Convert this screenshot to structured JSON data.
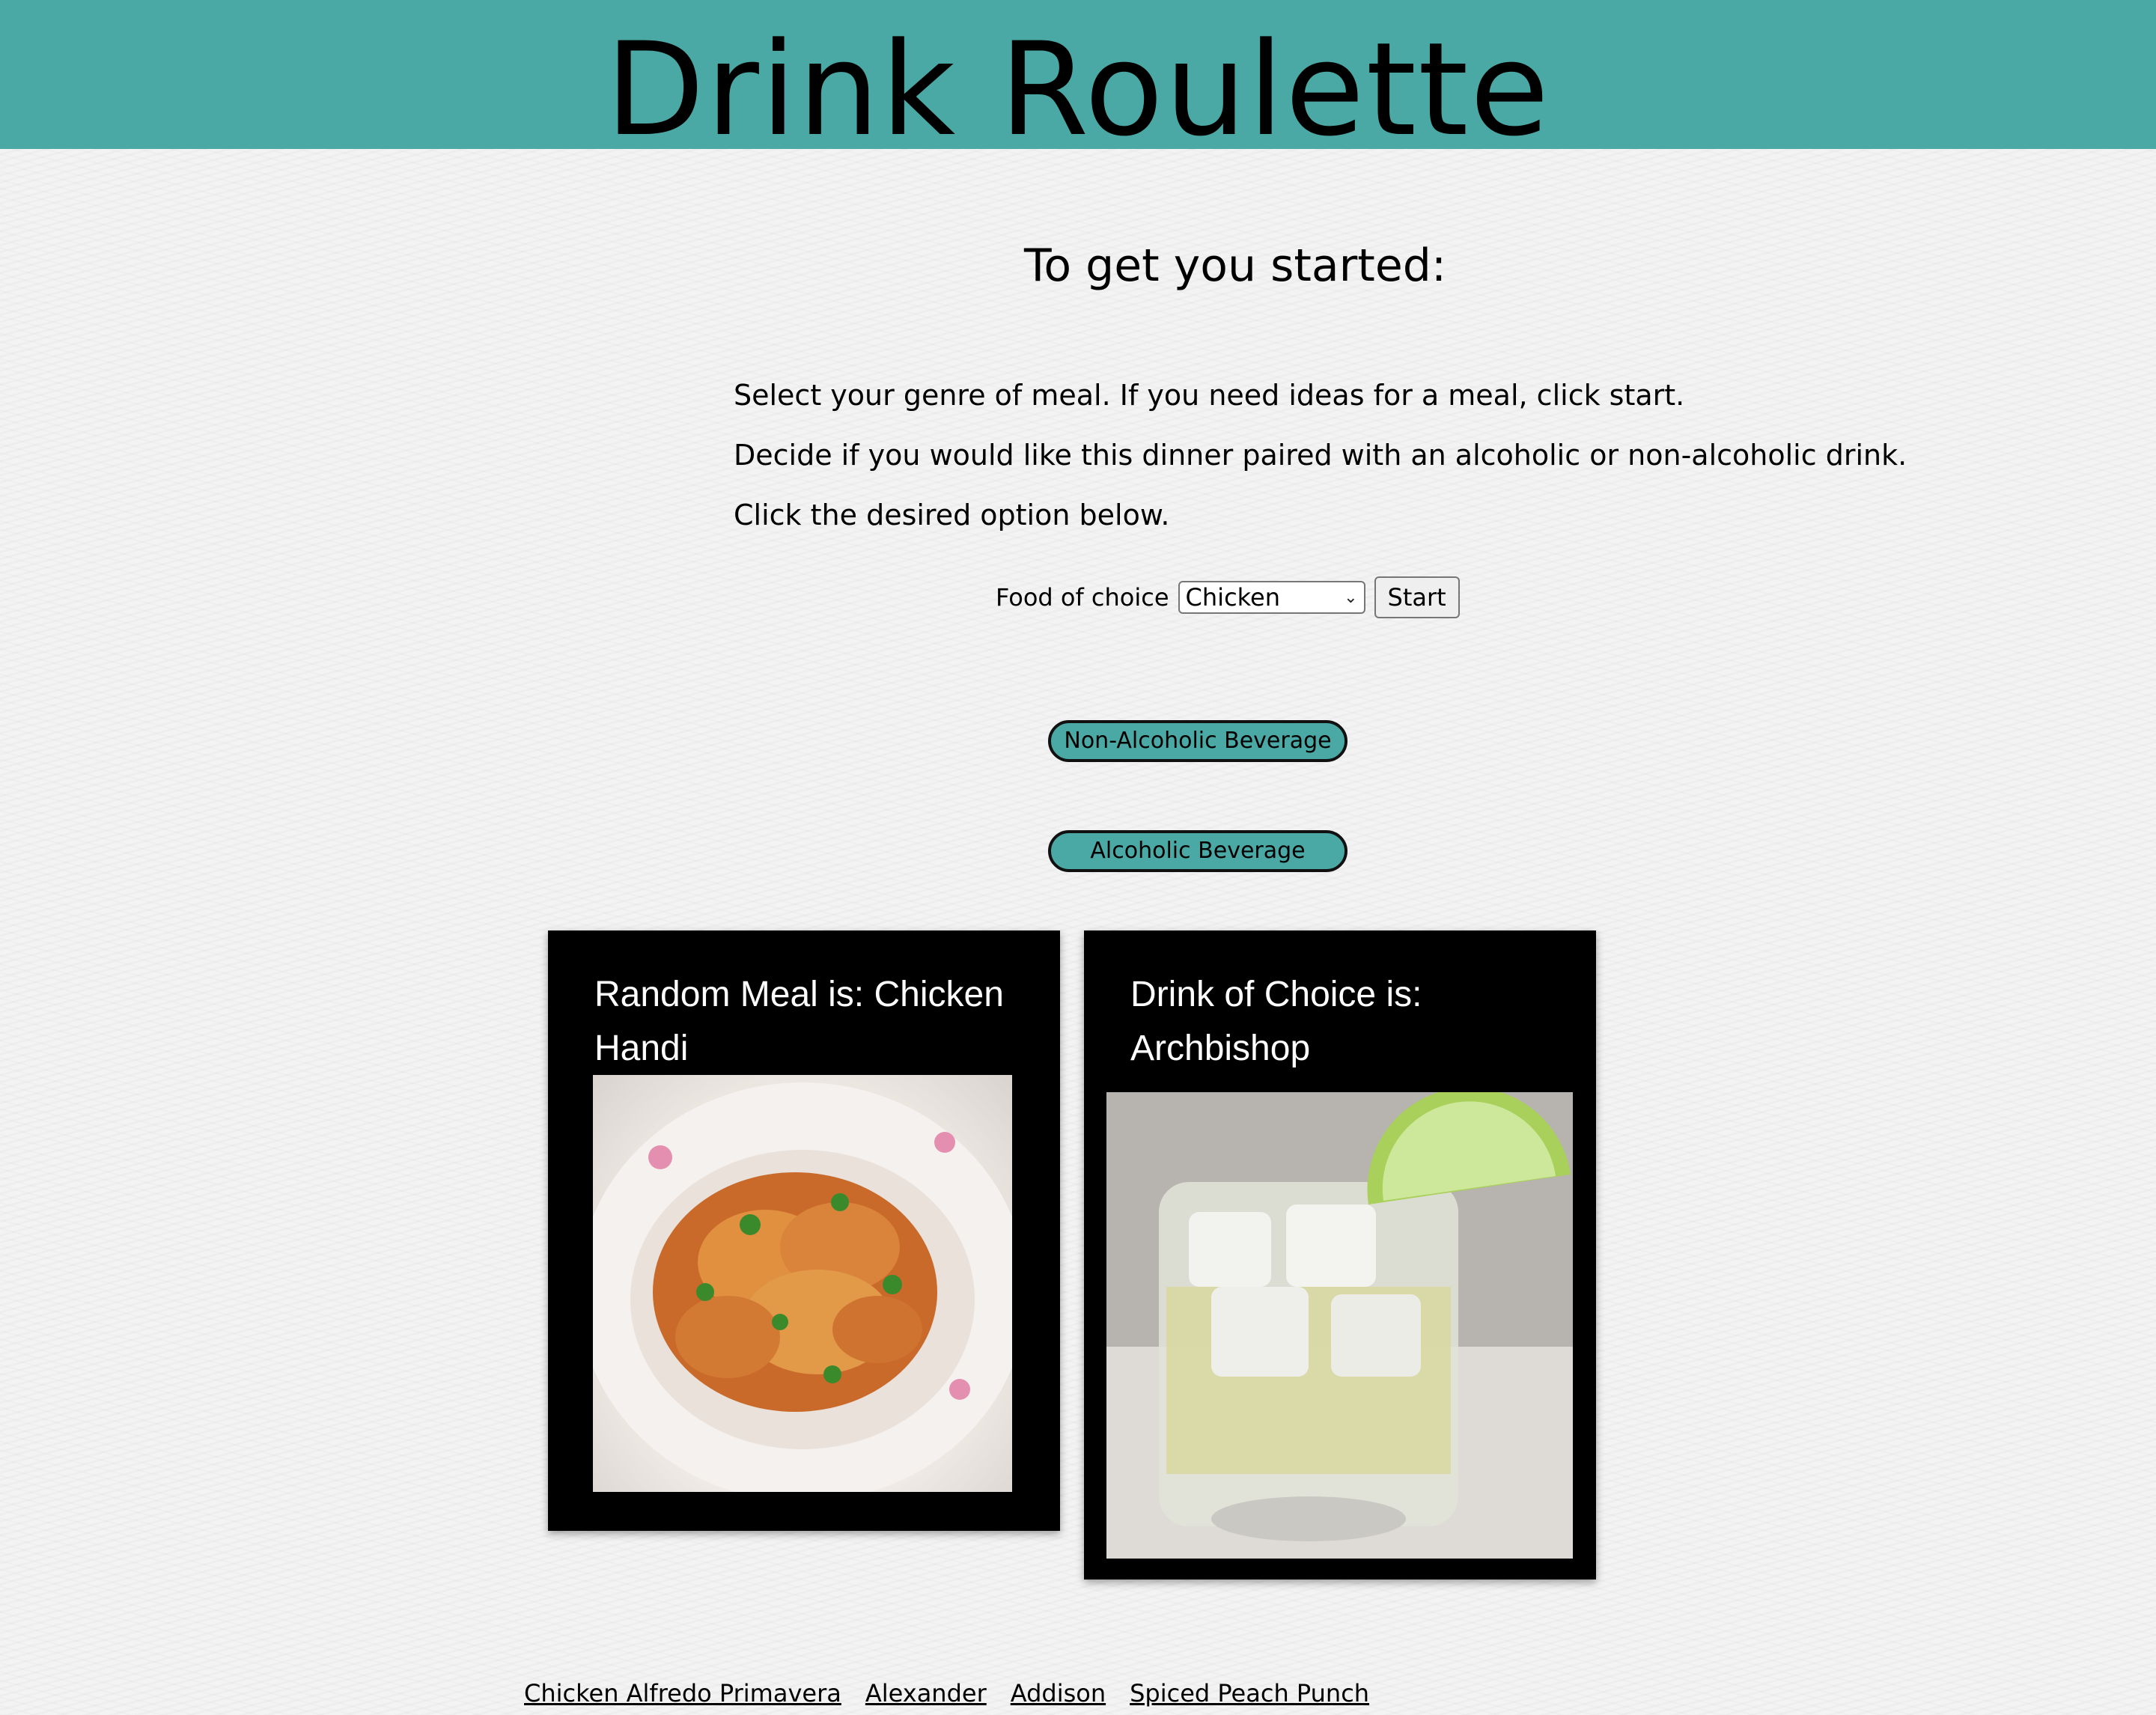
{
  "header": {
    "title": "Drink Roulette"
  },
  "intro": {
    "heading": "To get you started:",
    "lines": [
      "Select your genre of meal. If you need ideas for a meal, click start.",
      "Decide if you would like this dinner paired with an alcoholic or non-alcoholic drink.",
      "Click the desired option below."
    ]
  },
  "form": {
    "label": "Food of choice",
    "selected": "Chicken",
    "start_label": "Start"
  },
  "buttons": {
    "non_alcoholic": "Non-Alcoholic Beverage",
    "alcoholic": "Alcoholic Beverage"
  },
  "meal_card": {
    "title": "Random Meal is: Chicken Handi"
  },
  "drink_card": {
    "title": "Drink of Choice is: Archbishop"
  },
  "footer_links": [
    "Chicken Alfredo Primavera",
    "Alexander",
    "Addison",
    "Spiced Peach Punch"
  ],
  "colors": {
    "accent": "#4aa9a4",
    "card_bg": "#000000",
    "page_bg": "#f3f3f3"
  }
}
